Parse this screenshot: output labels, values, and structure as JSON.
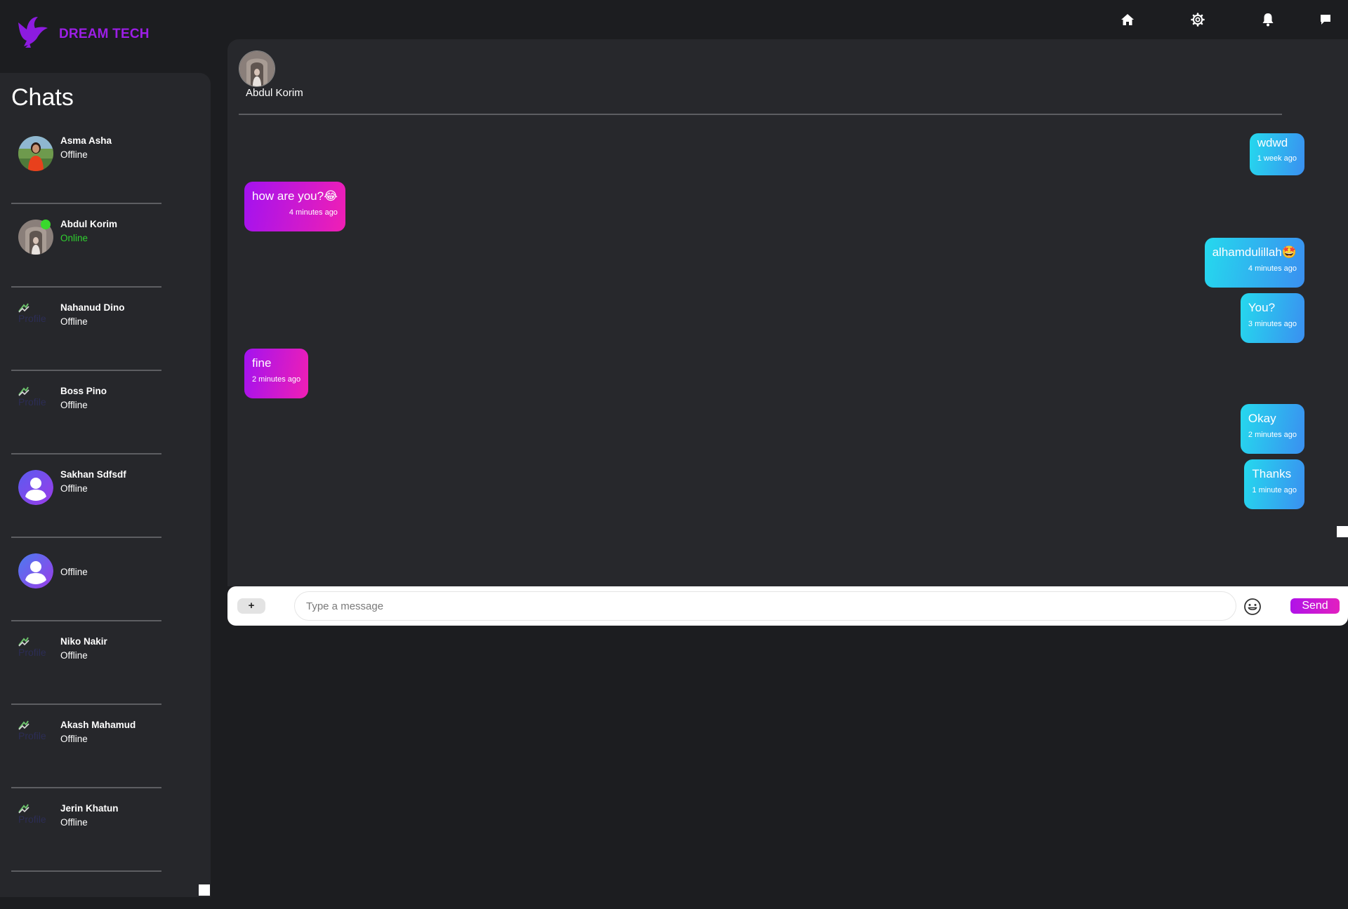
{
  "brand": {
    "name": "DREAM TECH",
    "icon": "dove-icon",
    "color": "#9c1ee6"
  },
  "topnav": {
    "items": [
      {
        "icon": "home-icon"
      },
      {
        "icon": "gear-icon"
      },
      {
        "icon": "bell-icon"
      },
      {
        "icon": "chat-icon"
      }
    ]
  },
  "sidebar": {
    "title": "Chats",
    "broken_image_alt": "Profile",
    "chats": [
      {
        "name": "Asma Asha",
        "status": "Offline",
        "avatar": "photo"
      },
      {
        "name": "Abdul Korim",
        "status": "Online",
        "avatar": "photo"
      },
      {
        "name": "Nahanud Dino",
        "status": "Offline",
        "avatar": "broken"
      },
      {
        "name": "Boss Pino",
        "status": "Offline",
        "avatar": "broken"
      },
      {
        "name": "Sakhan Sdfsdf",
        "status": "Offline",
        "avatar": "default"
      },
      {
        "name": "",
        "status": "Offline",
        "avatar": "default"
      },
      {
        "name": "Niko Nakir",
        "status": "Offline",
        "avatar": "broken"
      },
      {
        "name": "Akash Mahamud",
        "status": "Offline",
        "avatar": "broken"
      },
      {
        "name": "Jerin Khatun",
        "status": "Offline",
        "avatar": "broken"
      }
    ]
  },
  "conversation": {
    "contact_name": "Abdul Korim",
    "messages": [
      {
        "text": "wdwd",
        "time": "1 week ago",
        "side": "sent"
      },
      {
        "text": "how are you?😂",
        "time": "4 minutes ago",
        "side": "received"
      },
      {
        "text": "alhamdulillah🤩",
        "time": "4 minutes ago",
        "side": "sent"
      },
      {
        "text": "You?",
        "time": "3 minutes ago",
        "side": "sent"
      },
      {
        "text": "fine",
        "time": "2 minutes ago",
        "side": "received"
      },
      {
        "text": "Okay",
        "time": "2 minutes ago",
        "side": "sent"
      },
      {
        "text": "Thanks",
        "time": "1 minute ago",
        "side": "sent"
      }
    ]
  },
  "composer": {
    "plus_label": "+",
    "placeholder": "Type a message",
    "emoji_icon": "smiley-icon",
    "send_label": "Send"
  }
}
